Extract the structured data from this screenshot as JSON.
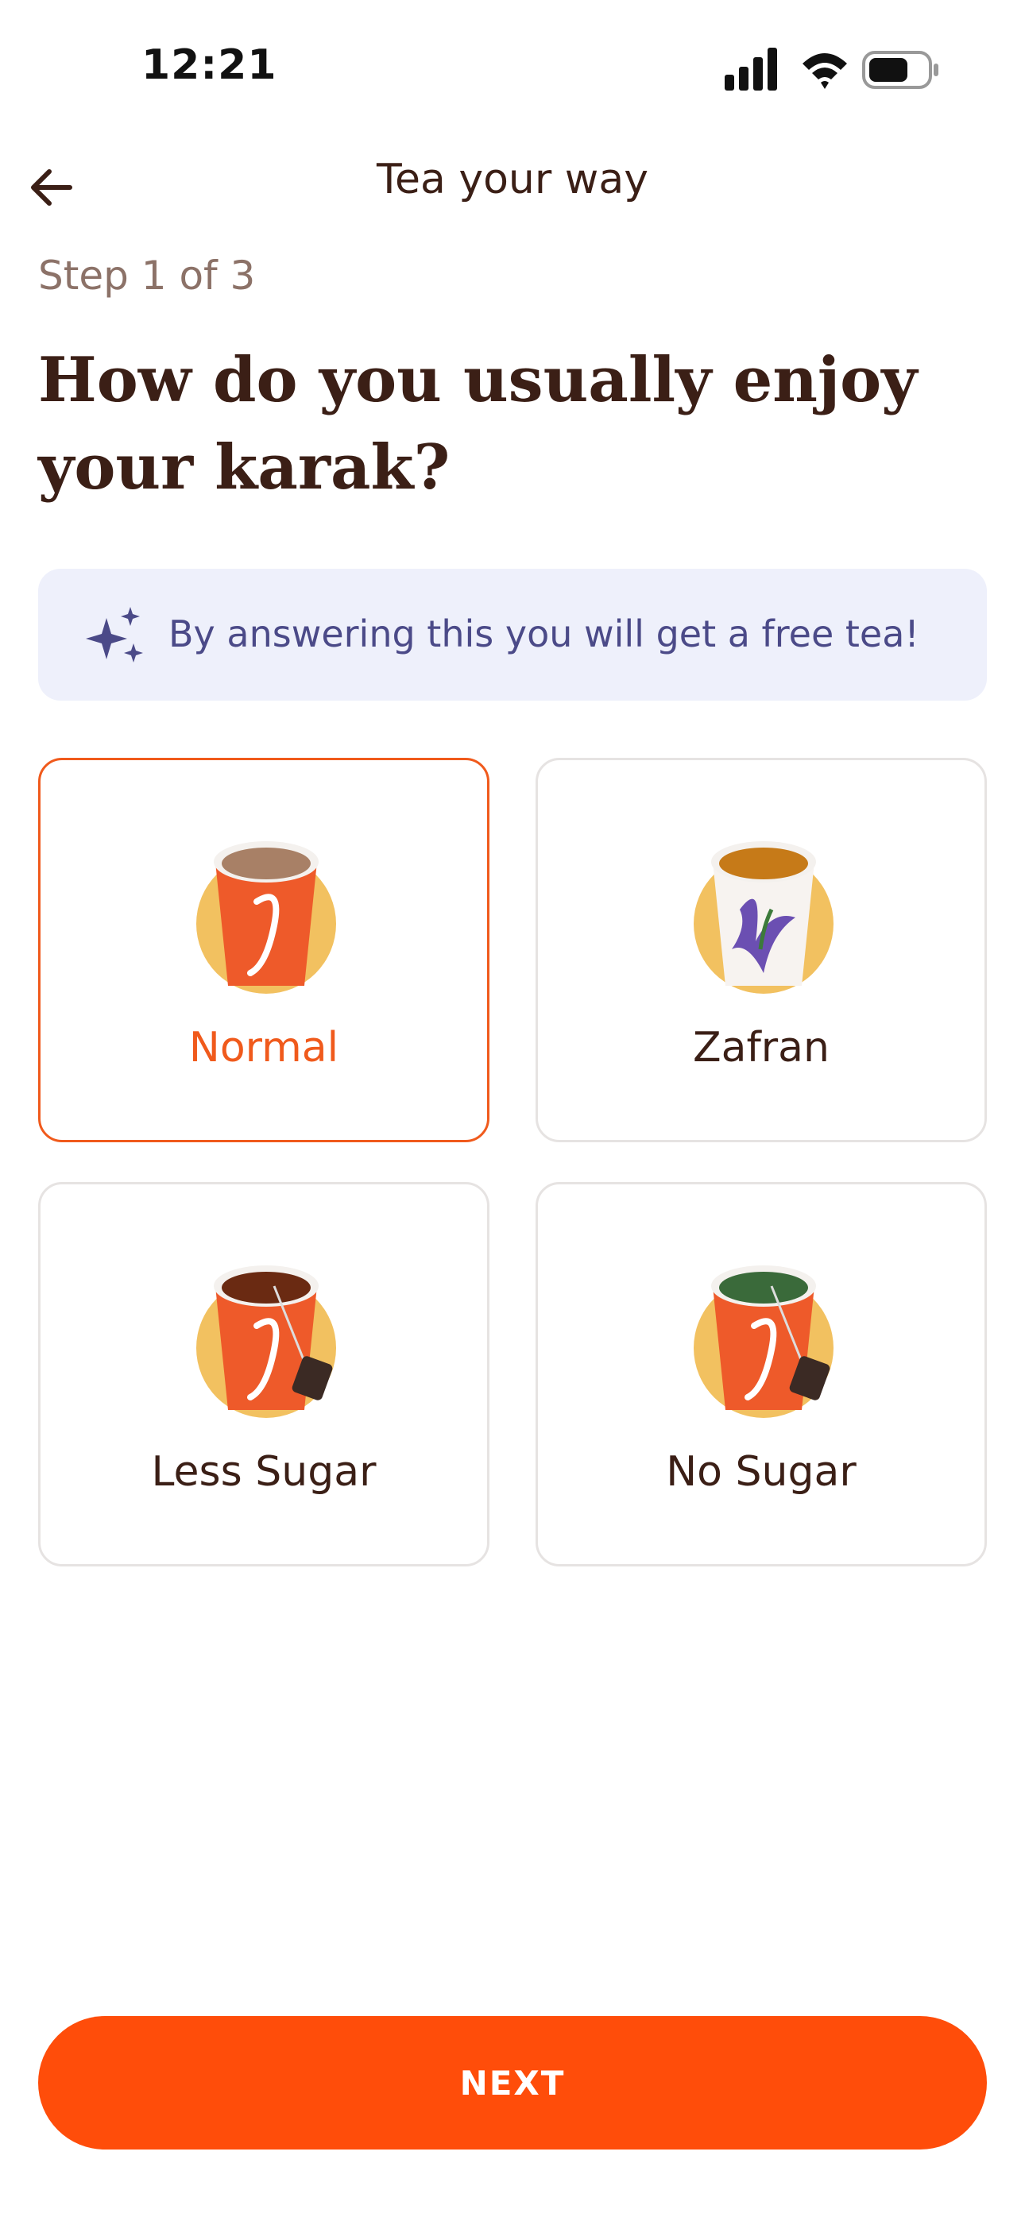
{
  "status_bar": {
    "time": "12:21"
  },
  "header": {
    "back_icon": "arrow-left-icon",
    "title": "Tea your way"
  },
  "step_label": "Step 1 of 3",
  "question": "How do you usually enjoy your karak?",
  "promo": {
    "icon": "sparkles-icon",
    "text": "By answering this you will get a free tea!"
  },
  "options": [
    {
      "label": "Normal",
      "selected": true
    },
    {
      "label": "Zafran",
      "selected": false
    },
    {
      "label": "Less Sugar",
      "selected": false
    },
    {
      "label": "No Sugar",
      "selected": false
    }
  ],
  "next_button": {
    "label": "NEXT"
  },
  "colors": {
    "accent": "#ff4d0a",
    "text": "#3b1f16",
    "muted": "#8c7268",
    "promo_bg": "#eef0fb",
    "promo_text": "#4b4a88",
    "cup_badge": "#f2c160"
  }
}
